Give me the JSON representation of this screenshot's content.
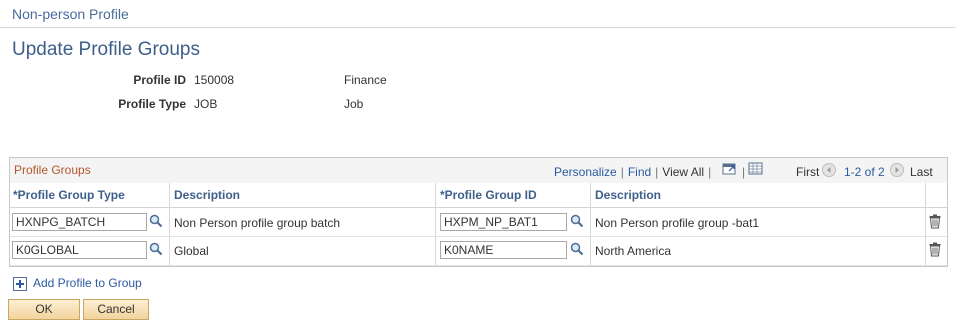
{
  "header": {
    "title": "Non-person Profile"
  },
  "page": {
    "title": "Update Profile Groups"
  },
  "profile": {
    "id_label": "Profile ID",
    "id_value": "150008",
    "id_desc": "Finance",
    "type_label": "Profile Type",
    "type_value": "JOB",
    "type_desc": "Job"
  },
  "grid": {
    "title": "Profile Groups",
    "nav": {
      "personalize": "Personalize",
      "find": "Find",
      "view_all": "View All",
      "first": "First",
      "range": "1-2 of 2",
      "last": "Last"
    },
    "columns": [
      "*Profile Group Type",
      "Description",
      "*Profile Group ID",
      "Description"
    ],
    "rows": [
      {
        "group_type": "HXNPG_BATCH",
        "type_desc": "Non Person profile group batch",
        "group_id": "HXPM_NP_BAT1",
        "id_desc": "Non Person profile group -bat1"
      },
      {
        "group_type": "K0GLOBAL",
        "type_desc": "Global",
        "group_id": "K0NAME",
        "id_desc": "North America"
      }
    ]
  },
  "actions": {
    "add_label": "Add Profile to Group",
    "ok_label": "OK",
    "cancel_label": "Cancel"
  },
  "icons": {
    "lookup": "magnifier-icon",
    "delete": "trash-icon",
    "add": "plus-icon",
    "colors": {
      "accent": "#3e5f8a",
      "grid_title": "#b2562c",
      "link": "#2c5aa0"
    }
  }
}
